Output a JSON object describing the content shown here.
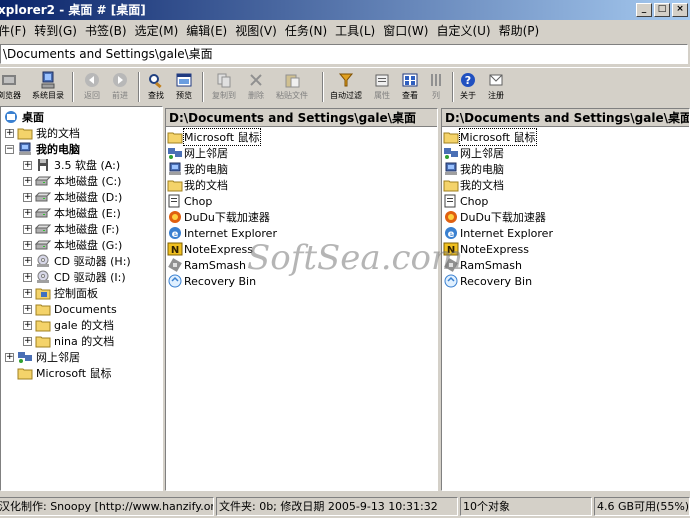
{
  "window": {
    "title": "xplorer2 - 桌面 # [桌面]",
    "controls": [
      "_",
      "□",
      "×"
    ]
  },
  "menu": [
    "件(F)",
    "转到(G)",
    "书签(B)",
    "选定(M)",
    "编辑(E)",
    "视图(V)",
    "任务(N)",
    "工具(L)",
    "窗口(W)",
    "自定义(U)",
    "帮助(P)"
  ],
  "address": {
    "value": "\\Documents and Settings\\gale\\桌面"
  },
  "toolbar": [
    {
      "label": "浏览器",
      "icon": "tree-icon",
      "enabled": true
    },
    {
      "label": "系统目录",
      "icon": "computer-icon",
      "enabled": true
    },
    {
      "label": "返回",
      "icon": "back-icon",
      "enabled": false
    },
    {
      "label": "前进",
      "icon": "forward-icon",
      "enabled": false
    },
    {
      "label": "查找",
      "icon": "find-icon",
      "enabled": true
    },
    {
      "label": "预览",
      "icon": "preview-icon",
      "enabled": true
    },
    {
      "label": "复制到",
      "icon": "copy-to-icon",
      "enabled": false
    },
    {
      "label": "删除",
      "icon": "delete-icon",
      "enabled": false
    },
    {
      "label": "粘贴文件",
      "icon": "paste-icon",
      "enabled": false
    },
    {
      "label": "自动过滤",
      "icon": "filter-icon",
      "enabled": true
    },
    {
      "label": "属性",
      "icon": "properties-icon",
      "enabled": false
    },
    {
      "label": "查看",
      "icon": "view-icon",
      "enabled": true
    },
    {
      "label": "列",
      "icon": "columns-icon",
      "enabled": false
    },
    {
      "label": "关于",
      "icon": "help-icon",
      "enabled": true
    },
    {
      "label": "注册",
      "icon": "register-icon",
      "enabled": true
    }
  ],
  "tree": [
    {
      "label": "桌面",
      "icon": "desktop-icon",
      "expander": "",
      "bold": true
    },
    {
      "label": "我的文档",
      "icon": "folder-icon",
      "expander": "+",
      "bold": false
    },
    {
      "label": "我的电脑",
      "icon": "computer-icon",
      "expander": "−",
      "bold": true
    },
    {
      "label": "3.5 软盘 (A:)",
      "icon": "floppy-icon",
      "expander": "+",
      "bold": false
    },
    {
      "label": "本地磁盘 (C:)",
      "icon": "drive-icon",
      "expander": "+",
      "bold": false
    },
    {
      "label": "本地磁盘 (D:)",
      "icon": "drive-icon",
      "expander": "+",
      "bold": false
    },
    {
      "label": "本地磁盘 (E:)",
      "icon": "drive-icon",
      "expander": "+",
      "bold": false
    },
    {
      "label": "本地磁盘 (F:)",
      "icon": "drive-icon",
      "expander": "+",
      "bold": false
    },
    {
      "label": "本地磁盘 (G:)",
      "icon": "drive-icon",
      "expander": "+",
      "bold": false
    },
    {
      "label": "CD 驱动器 (H:)",
      "icon": "cd-icon",
      "expander": "+",
      "bold": false
    },
    {
      "label": "CD 驱动器 (I:)",
      "icon": "cd-icon",
      "expander": "+",
      "bold": false
    },
    {
      "label": "控制面板",
      "icon": "control-panel-icon",
      "expander": "+",
      "bold": false
    },
    {
      "label": "Documents",
      "icon": "folder-icon",
      "expander": "+",
      "bold": false
    },
    {
      "label": "gale 的文档",
      "icon": "folder-icon",
      "expander": "+",
      "bold": false
    },
    {
      "label": "nina 的文档",
      "icon": "folder-icon",
      "expander": "+",
      "bold": false
    },
    {
      "label": "网上邻居",
      "icon": "network-icon",
      "expander": "+",
      "bold": false
    },
    {
      "label": "Microsoft 鼠标",
      "icon": "folder-icon",
      "expander": "",
      "bold": false
    }
  ],
  "left_pane": {
    "header": "D:\\Documents and Settings\\gale\\桌面",
    "items": [
      {
        "label": "Microsoft 鼠标",
        "icon": "folder-icon",
        "selected": true
      },
      {
        "label": "网上邻居",
        "icon": "network-icon",
        "selected": false
      },
      {
        "label": "我的电脑",
        "icon": "computer-icon",
        "selected": false
      },
      {
        "label": "我的文档",
        "icon": "folder-icon",
        "selected": false
      },
      {
        "label": "Chop",
        "icon": "shortcut-icon",
        "selected": false
      },
      {
        "label": "DuDu下载加速器",
        "icon": "dudu-icon",
        "selected": false
      },
      {
        "label": "Internet Explorer",
        "icon": "ie-icon",
        "selected": false
      },
      {
        "label": "NoteExpress",
        "icon": "noteexpress-icon",
        "selected": false
      },
      {
        "label": "RamSmash",
        "icon": "app-icon",
        "selected": false
      },
      {
        "label": "Recovery Bin",
        "icon": "recycle-icon",
        "selected": false
      }
    ]
  },
  "right_pane": {
    "header": "D:\\Documents and Settings\\gale\\桌面",
    "items": [
      {
        "label": "Microsoft 鼠标",
        "icon": "folder-icon",
        "selected": true
      },
      {
        "label": "网上邻居",
        "icon": "network-icon",
        "selected": false
      },
      {
        "label": "我的电脑",
        "icon": "computer-icon",
        "selected": false
      },
      {
        "label": "我的文档",
        "icon": "folder-icon",
        "selected": false
      },
      {
        "label": "Chop",
        "icon": "shortcut-icon",
        "selected": false
      },
      {
        "label": "DuDu下载加速器",
        "icon": "dudu-icon",
        "selected": false
      },
      {
        "label": "Internet Explorer",
        "icon": "ie-icon",
        "selected": false
      },
      {
        "label": "NoteExpress",
        "icon": "noteexpress-icon",
        "selected": false
      },
      {
        "label": "RamSmash",
        "icon": "app-icon",
        "selected": false
      },
      {
        "label": "Recovery Bin",
        "icon": "recycle-icon",
        "selected": false
      }
    ]
  },
  "watermark": "SoftSea.com",
  "status": {
    "credit": "汉化制作: Snoopy [http://www.hanzify.org]",
    "info": "文件夹: 0b; 修改日期 2005-9-13 10:31:32",
    "count": "10个对象",
    "free": "4.6 GB可用(55%)"
  },
  "colors": {
    "title_from": "#0a246a",
    "title_to": "#a6caf0",
    "face": "#d4d0c8",
    "folder": "#f4d36a"
  }
}
